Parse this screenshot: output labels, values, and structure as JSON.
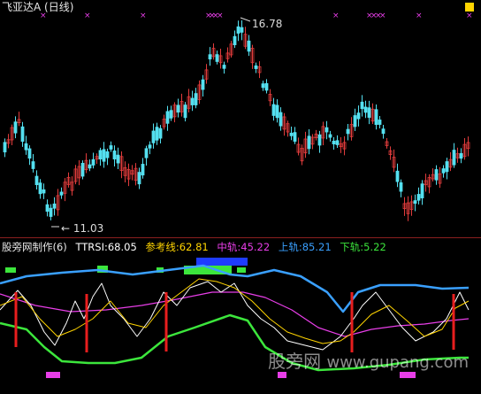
{
  "window": {
    "title": "飞亚达A (日线)"
  },
  "price_panel": {
    "high_marker": "16.78",
    "low_marker": "11.03",
    "candle_up_color": "#e23c3c",
    "candle_down_color": "#54e0f0",
    "signal_mark_color": "#e83ee8"
  },
  "indicator_row": {
    "name": "股旁网制作(6)",
    "ttrsi": "TTRSI:68.05",
    "ref_line": "参考线:62.81",
    "mid": "中轨:45.22",
    "upper": "上轨:85.21",
    "lower": "下轨:5.22",
    "colors": {
      "name": "#e8e8e8",
      "ttrsi": "#ffffff",
      "ref": "#ffd400",
      "mid": "#e83ee8",
      "upper": "#3aa0ff",
      "lower": "#3ce63c"
    }
  },
  "watermark": {
    "cn": "股旁网",
    "url": "www.gupang.com"
  }
}
